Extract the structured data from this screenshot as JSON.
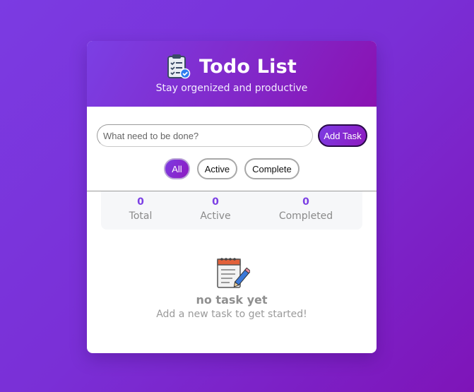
{
  "header": {
    "title": "Todo List",
    "subtitle": "Stay orgenized and productive",
    "icon": "clipboard-check-icon"
  },
  "input": {
    "placeholder": "What need to be done?",
    "value": "",
    "add_label": "Add Task"
  },
  "filters": [
    {
      "label": "All",
      "active": true
    },
    {
      "label": "Active",
      "active": false
    },
    {
      "label": "Complete",
      "active": false
    }
  ],
  "stats": [
    {
      "value": "0",
      "label": "Total"
    },
    {
      "value": "0",
      "label": "Active"
    },
    {
      "value": "0",
      "label": "Completed"
    }
  ],
  "empty": {
    "icon": "notepad-pencil-icon",
    "title": "no task yet",
    "subtitle": "Add a new task to get started!"
  },
  "colors": {
    "accent": "#7b3fe4",
    "accent_dark": "#8e1ac0",
    "background_start": "#7b3be2",
    "background_end": "#7e14b8"
  }
}
